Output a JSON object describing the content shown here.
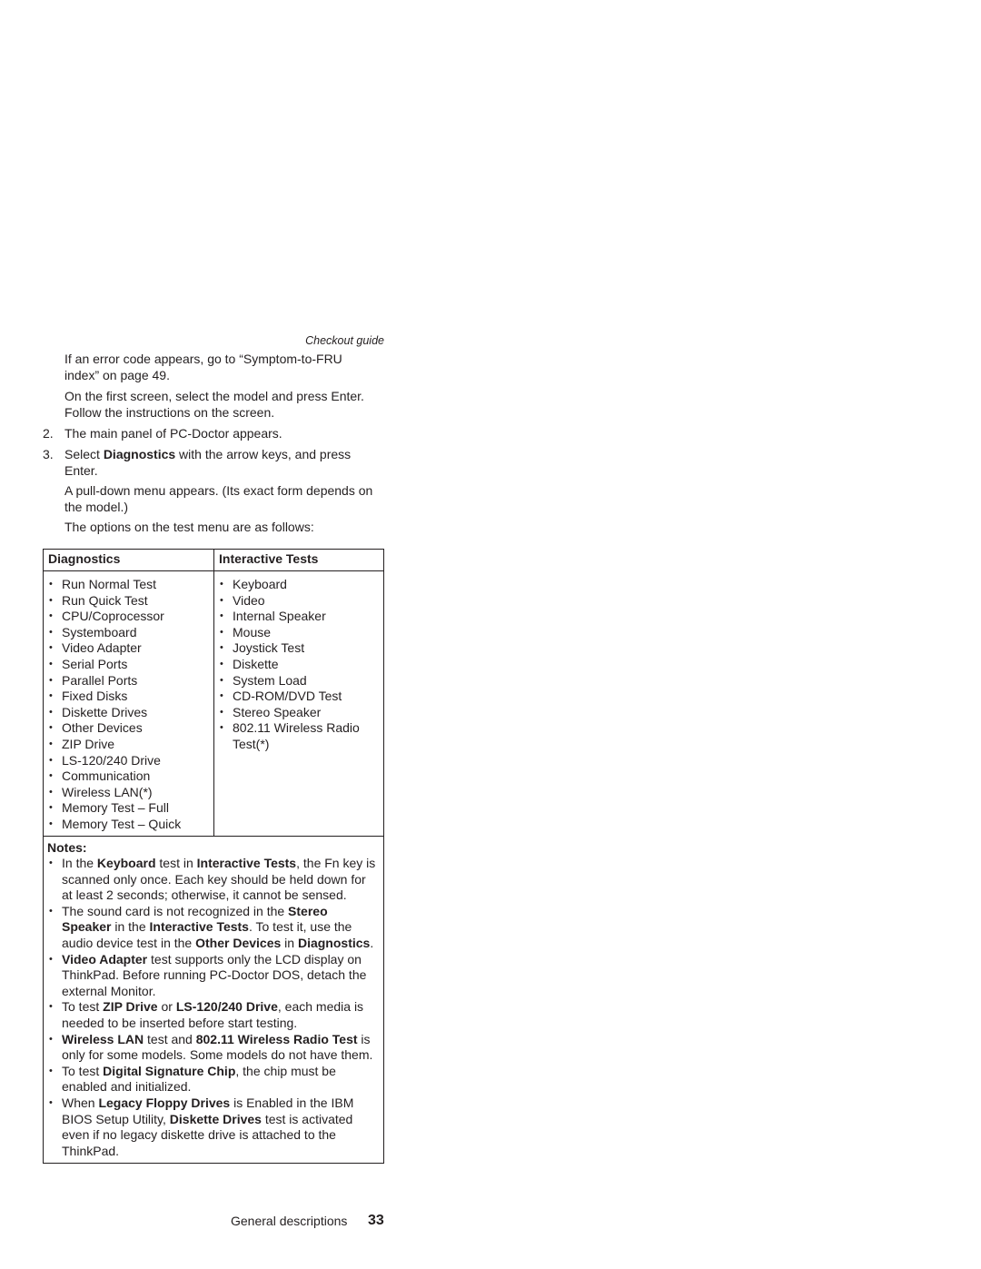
{
  "header": {
    "running_title": "Checkout guide"
  },
  "body": {
    "p1": "If an error code appears, go to “Symptom-to-FRU index” on page 49.",
    "p2": "On the first screen, select the model and press Enter. Follow the instructions on the screen.",
    "step2": {
      "num": "2.",
      "text": "The main panel of PC-Doctor appears."
    },
    "step3": {
      "num": "3.",
      "pre": "Select ",
      "bold": "Diagnostics",
      "post": " with the arrow keys, and press Enter."
    },
    "p3": "A pull-down menu appears. (Its exact form depends on the model.)",
    "p4": "The options on the test menu are as follows:"
  },
  "table": {
    "headers": [
      "Diagnostics",
      "Interactive Tests"
    ],
    "diagnostics": [
      "Run Normal Test",
      "Run Quick Test",
      "CPU/Coprocessor",
      "Systemboard",
      "Video Adapter",
      "Serial Ports",
      "Parallel Ports",
      "Fixed Disks",
      "Diskette Drives",
      "Other Devices",
      "ZIP Drive",
      "LS-120/240 Drive",
      "Communication",
      "Wireless LAN(*)",
      "Memory Test – Full",
      "Memory Test – Quick"
    ],
    "interactive": [
      "Keyboard",
      "Video",
      "Internal Speaker",
      "Mouse",
      "Joystick Test",
      "Diskette",
      "System Load",
      "CD-ROM/DVD Test",
      "Stereo Speaker",
      "802.11 Wireless Radio Test(*)"
    ],
    "notes_title": "Notes:",
    "notes": [
      [
        {
          "t": "In the "
        },
        {
          "t": "Keyboard",
          "b": true
        },
        {
          "t": " test in "
        },
        {
          "t": "Interactive Tests",
          "b": true
        },
        {
          "t": ", the Fn key is scanned only once. Each key should be held down for at least 2 seconds; otherwise, it cannot be sensed."
        }
      ],
      [
        {
          "t": "The sound card is not recognized in the "
        },
        {
          "t": "Stereo Speaker",
          "b": true
        },
        {
          "t": " in the "
        },
        {
          "t": "Interactive Tests",
          "b": true
        },
        {
          "t": ". To test it, use the audio device test in the "
        },
        {
          "t": "Other Devices",
          "b": true
        },
        {
          "t": " in "
        },
        {
          "t": "Diagnostics",
          "b": true
        },
        {
          "t": "."
        }
      ],
      [
        {
          "t": "Video Adapter",
          "b": true
        },
        {
          "t": " test supports only the LCD display on ThinkPad. Before running PC-Doctor DOS, detach the external Monitor."
        }
      ],
      [
        {
          "t": "To test "
        },
        {
          "t": "ZIP Drive",
          "b": true
        },
        {
          "t": " or "
        },
        {
          "t": "LS-120/240 Drive",
          "b": true
        },
        {
          "t": ", each media is needed to be inserted before start testing."
        }
      ],
      [
        {
          "t": "Wireless LAN",
          "b": true
        },
        {
          "t": " test and "
        },
        {
          "t": "802.11 Wireless Radio Test",
          "b": true
        },
        {
          "t": " is only for some models. Some models do not have them."
        }
      ],
      [
        {
          "t": "To test "
        },
        {
          "t": "Digital Signature Chip",
          "b": true
        },
        {
          "t": ", the chip must be enabled and initialized."
        }
      ],
      [
        {
          "t": "When "
        },
        {
          "t": "Legacy Floppy Drives",
          "b": true
        },
        {
          "t": " is Enabled in the IBM BIOS Setup Utility, "
        },
        {
          "t": "Diskette Drives",
          "b": true
        },
        {
          "t": " test is activated even if no legacy diskette drive is attached to the ThinkPad."
        }
      ]
    ]
  },
  "footer": {
    "section": "General descriptions",
    "page": "33"
  }
}
